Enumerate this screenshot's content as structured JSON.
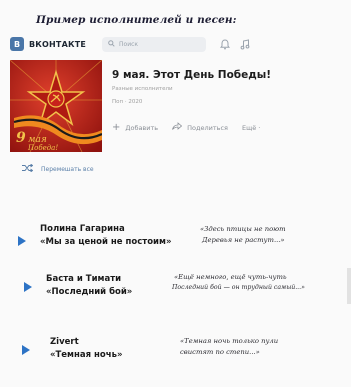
{
  "caption": "Пример исполнителей и песен:",
  "vk": {
    "logo_letter": "В",
    "name": "ВКОНТАКТЕ",
    "search_placeholder": "Поиск",
    "search_icon": "search-icon",
    "bell_icon": "bell-icon",
    "music_icon": "music-note-icon"
  },
  "album": {
    "title": "9 мая. Этот День Победы!",
    "artist": "Разные исполнители",
    "meta": "Поп · 2020",
    "cover_text_top": "9",
    "cover_text": "мая",
    "cover_text_bottom": "Победа!",
    "actions": {
      "add": "Добавить",
      "share": "Поделиться",
      "more": "Ещё ·"
    }
  },
  "shuffle_label": "Перемешать все",
  "tracks": [
    {
      "artist": "Полина Гагарина",
      "song": "«Мы за ценой не постоим»",
      "lyric1": "«Здесь птицы не поют",
      "lyric2": "Деревья не растут...»"
    },
    {
      "artist": "Баста и Тимати",
      "song": "«Последний бой»",
      "lyric1": "«Ещё немного, ещё чуть-чуть",
      "lyric2": "Последний бой — он трудный самый...»"
    },
    {
      "artist": "Zivert",
      "song": "«Темная ночь»",
      "lyric1": "«Темная ночь только пули",
      "lyric2": "свистят по степи...»"
    }
  ],
  "colors": {
    "vk_blue": "#4a76a8",
    "play_blue": "#2d73c5",
    "cover_red": "#c8231c"
  }
}
